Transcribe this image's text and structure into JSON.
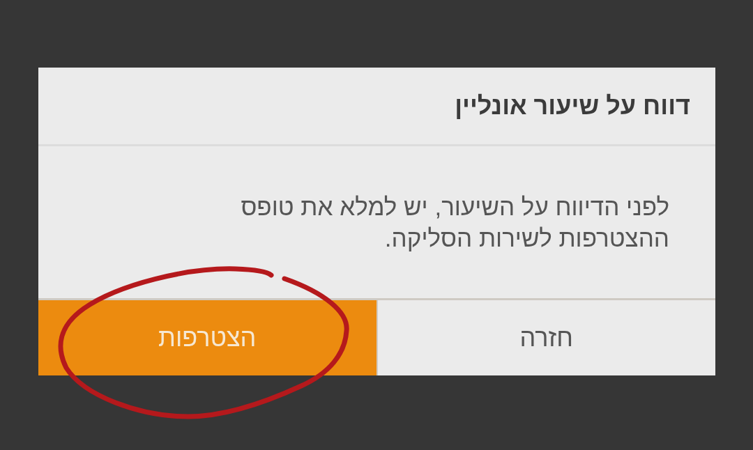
{
  "dialog": {
    "title": "דווח על שיעור אונליין",
    "message": "לפני הדיווח על השיעור, יש למלא את טופס ההצטרפות לשירות הסליקה.",
    "buttons": [
      {
        "label": "חזרה",
        "kind": "secondary",
        "circled": false
      },
      {
        "label": "הצטרפות",
        "kind": "primary",
        "circled": true
      }
    ]
  }
}
